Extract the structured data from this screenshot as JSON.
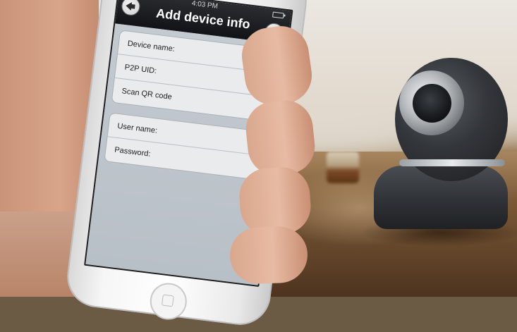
{
  "status_bar": {
    "time": "4:03 PM"
  },
  "nav_bar": {
    "title": "Add device info"
  },
  "form": {
    "device_group": [
      {
        "label": "Device name:"
      },
      {
        "label": "P2P UID:"
      },
      {
        "label": "Scan QR code"
      }
    ],
    "credentials_group": [
      {
        "label": "User name:"
      },
      {
        "label": "Password:"
      }
    ]
  },
  "icons": {
    "back": "back-arrow-icon",
    "save": "save-disk-icon",
    "qr": "qr-code-icon",
    "battery": "battery-icon"
  },
  "colors": {
    "nav_bar": "#1c1e21",
    "form_background": "#bfc6cc",
    "group_background": "#e9ebed"
  }
}
